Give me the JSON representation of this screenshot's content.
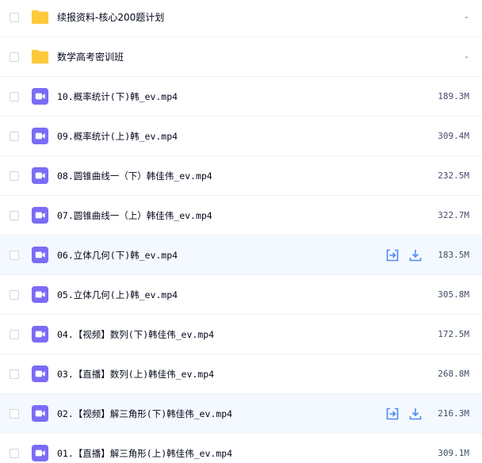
{
  "files": [
    {
      "type": "folder",
      "name": "续报资料-核心200题计划",
      "size": "-",
      "hover": false
    },
    {
      "type": "folder",
      "name": "数学高考密训班",
      "size": "-",
      "hover": false
    },
    {
      "type": "video",
      "name": "10.概率统计(下)韩_ev.mp4",
      "size": "189.3M",
      "hover": false
    },
    {
      "type": "video",
      "name": "09.概率统计(上)韩_ev.mp4",
      "size": "309.4M",
      "hover": false
    },
    {
      "type": "video",
      "name": "08.圆锥曲线一（下）韩佳伟_ev.mp4",
      "size": "232.5M",
      "hover": false
    },
    {
      "type": "video",
      "name": "07.圆锥曲线一（上）韩佳伟_ev.mp4",
      "size": "322.7M",
      "hover": false
    },
    {
      "type": "video",
      "name": "06.立体几何(下)韩_ev.mp4",
      "size": "183.5M",
      "hover": true
    },
    {
      "type": "video",
      "name": "05.立体几何(上)韩_ev.mp4",
      "size": "305.8M",
      "hover": false
    },
    {
      "type": "video",
      "name": "04.【视频】数列(下)韩佳伟_ev.mp4",
      "size": "172.5M",
      "hover": false
    },
    {
      "type": "video",
      "name": "03.【直播】数列(上)韩佳伟_ev.mp4",
      "size": "268.8M",
      "hover": false
    },
    {
      "type": "video",
      "name": "02.【视频】解三角形(下)韩佳伟_ev.mp4",
      "size": "216.3M",
      "hover": true
    },
    {
      "type": "video",
      "name": "01.【直播】解三角形(上)韩佳伟_ev.mp4",
      "size": "309.1M",
      "hover": false
    }
  ],
  "colors": {
    "folder": "#ffc93c",
    "video": "#7b6cf6",
    "action": "#4b8bf5"
  },
  "icons": {
    "folder": "folder-icon",
    "video": "video-file-icon",
    "share": "share-icon",
    "download": "download-icon"
  }
}
